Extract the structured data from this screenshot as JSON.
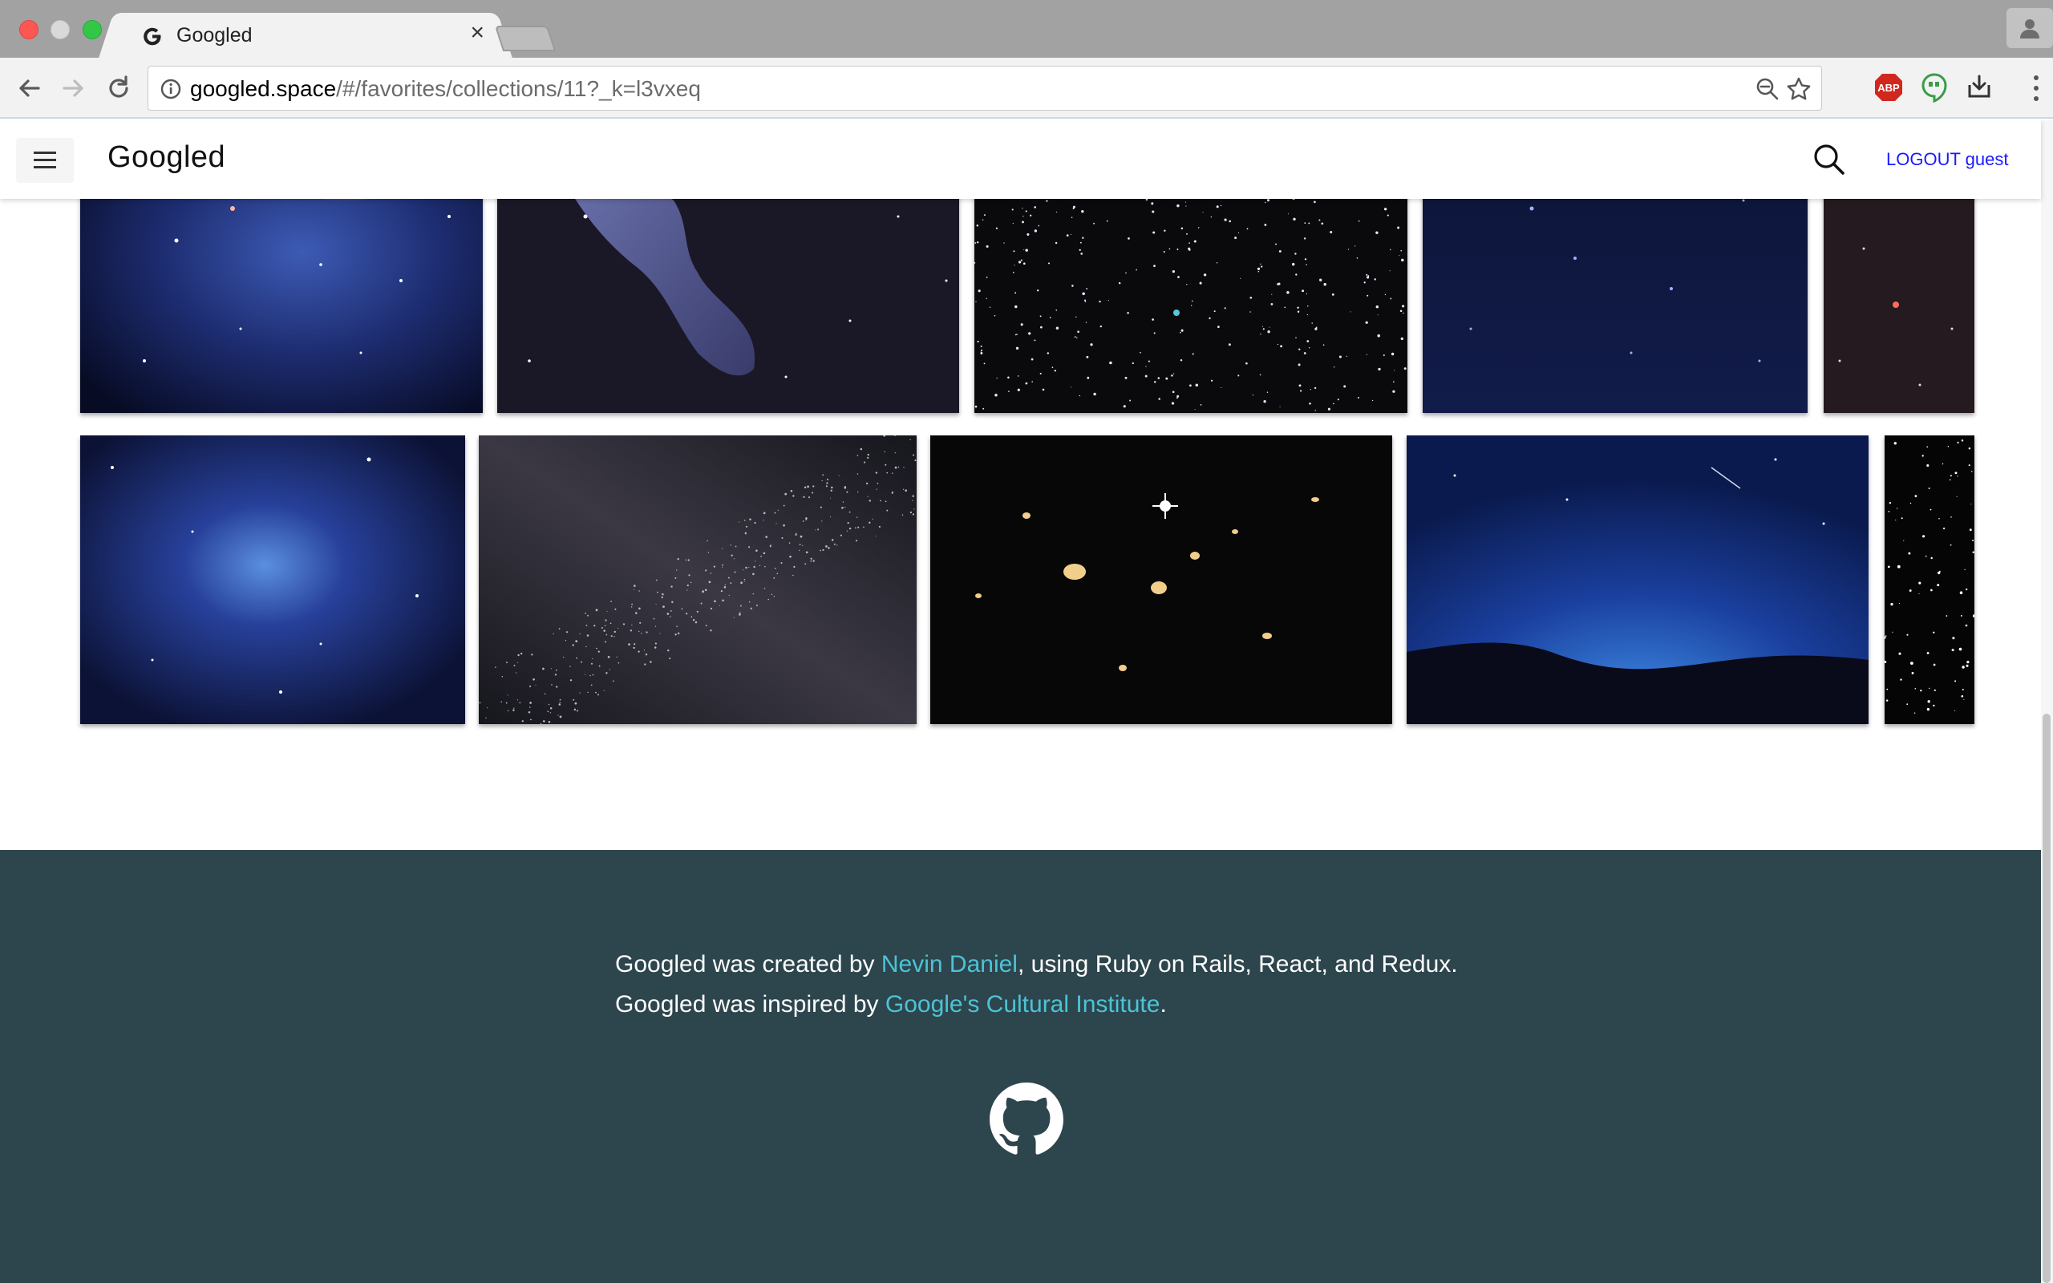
{
  "browser": {
    "tab_title": "Googled",
    "tab_close": "×",
    "url_host": "googled.space",
    "url_path": "/#/favorites/collections/11?_k=l3vxeq",
    "abp_label": "ABP"
  },
  "header": {
    "brand": "Googled",
    "logout_label": "LOGOUT",
    "username": "guest"
  },
  "gallery": {
    "rows": [
      [
        "nebula-blue",
        "witch-head-nebula",
        "star-cluster",
        "deep-blue-sky",
        "red-star-field"
      ],
      [
        "spiral-galaxy",
        "milky-way-band",
        "galaxy-cluster",
        "blue-horizon",
        "dense-starfield"
      ]
    ]
  },
  "footer": {
    "created_prefix": "Googled was created by ",
    "author_link": "Nevin Daniel",
    "created_suffix": ", using Ruby on Rails, React, and Redux.",
    "inspired_prefix": "Googled was inspired by ",
    "inspiration_link": "Google's Cultural Institute",
    "inspired_suffix": ".",
    "link_color": "#4cc3d6",
    "background": "#2d454c"
  }
}
